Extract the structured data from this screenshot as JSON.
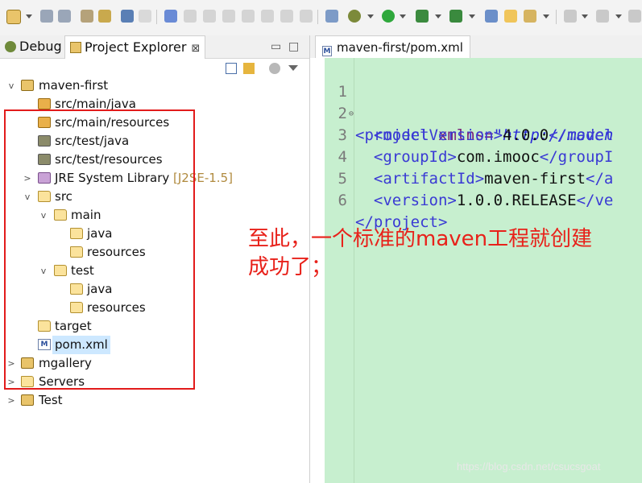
{
  "toolbar": {
    "icons": [
      "new-icon",
      "save-icon",
      "save-all-icon",
      "debug-icon",
      "run-icon",
      "external-tools-icon",
      "search-icon",
      "back-icon",
      "forward-icon"
    ]
  },
  "left_panel": {
    "tabs": [
      {
        "label": "Debug",
        "icon": "debug-icon"
      },
      {
        "label": "Project Explorer",
        "icon": "project-explorer-icon",
        "close": "⊠"
      }
    ],
    "minimize": "▭",
    "maximize": "□",
    "tree": [
      {
        "label": "maven-first",
        "icon": "maven-project-icon",
        "expanded": true
      },
      {
        "label": "src/main/java",
        "icon": "source-folder-icon"
      },
      {
        "label": "src/main/resources",
        "icon": "source-folder-icon"
      },
      {
        "label": "src/test/java",
        "icon": "source-folder-icon"
      },
      {
        "label": "src/test/resources",
        "icon": "source-folder-icon"
      },
      {
        "label": "JRE System Library",
        "decoration": "[J2SE-1.5]",
        "icon": "library-icon"
      },
      {
        "label": "src",
        "icon": "folder-icon"
      },
      {
        "label": "main",
        "icon": "folder-icon"
      },
      {
        "label": "java",
        "icon": "folder-icon"
      },
      {
        "label": "resources",
        "icon": "folder-icon"
      },
      {
        "label": "test",
        "icon": "folder-icon"
      },
      {
        "label": "java",
        "icon": "folder-icon"
      },
      {
        "label": "resources",
        "icon": "folder-icon"
      },
      {
        "label": "target",
        "icon": "folder-icon"
      },
      {
        "label": "pom.xml",
        "icon": "xml-file-icon",
        "selected": true
      },
      {
        "label": "mgallery",
        "icon": "maven-project-icon"
      },
      {
        "label": "Servers",
        "icon": "folder-icon"
      },
      {
        "label": "Test",
        "icon": "project-icon"
      }
    ]
  },
  "editor": {
    "tab_label": "maven-first/pom.xml",
    "lines": [
      {
        "num": "1",
        "open": "<project",
        "attr": " xmlns=",
        "val": "\"http://maven",
        "text": "",
        "close": ""
      },
      {
        "num": "2",
        "open": "  <modelVersion>",
        "attr": "",
        "val": "",
        "text": "4.0.0",
        "close": "</model"
      },
      {
        "num": "3",
        "open": "  <groupId>",
        "attr": "",
        "val": "",
        "text": "com.imooc",
        "close": "</groupI"
      },
      {
        "num": "4",
        "open": "  <artifactId>",
        "attr": "",
        "val": "",
        "text": "maven-first",
        "close": "</a"
      },
      {
        "num": "5",
        "open": "  <version>",
        "attr": "",
        "val": "",
        "text": "1.0.0.RELEASE",
        "close": "</ve"
      },
      {
        "num": "6",
        "open": "</project>",
        "attr": "",
        "val": "",
        "text": "",
        "close": ""
      }
    ]
  },
  "annotation": {
    "line1": "至此，一个标准的maven工程就创建",
    "line2": "成功了；"
  },
  "watermark": "https://blog.csdn.net/csucsgoat",
  "colors": {
    "highlight": "#e21b1b",
    "editor_bg": "#c7efcf",
    "annotation": "#e8211a"
  }
}
